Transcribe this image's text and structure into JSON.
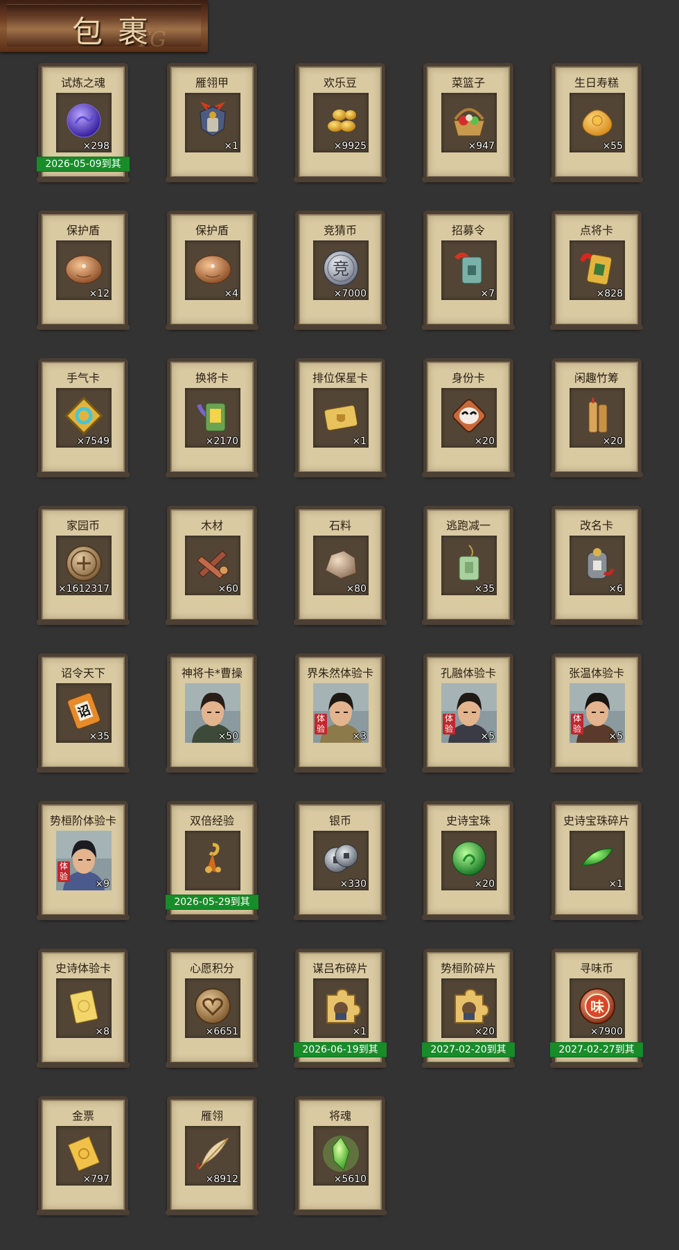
{
  "header": {
    "title": "包裹",
    "deco_text": "TG"
  },
  "items": [
    {
      "name": "试炼之魂",
      "count": "×298",
      "icon": "purple-soul-orb-icon",
      "expiry": "2026-05-09到其"
    },
    {
      "name": "雁翎甲",
      "count": "×1",
      "icon": "armor-icon"
    },
    {
      "name": "欢乐豆",
      "count": "×9925",
      "icon": "gold-beans-icon"
    },
    {
      "name": "菜篮子",
      "count": "×947",
      "icon": "vegetable-basket-icon"
    },
    {
      "name": "生日寿糕",
      "count": "×55",
      "icon": "birthday-cake-icon"
    },
    {
      "name": "保护盾",
      "count": "×12",
      "icon": "shield-icon"
    },
    {
      "name": "保护盾",
      "count": "×4",
      "icon": "shield-icon"
    },
    {
      "name": "竞猜币",
      "count": "×7000",
      "icon": "silver-coin-icon",
      "coin_char": "竞"
    },
    {
      "name": "招募令",
      "count": "×7",
      "icon": "recruit-token-icon"
    },
    {
      "name": "点将卡",
      "count": "×828",
      "icon": "general-card-icon"
    },
    {
      "name": "手气卡",
      "count": "×7549",
      "icon": "luck-card-icon"
    },
    {
      "name": "换将卡",
      "count": "×2170",
      "icon": "swap-card-icon"
    },
    {
      "name": "排位保星卡",
      "count": "×1",
      "icon": "rank-star-card-icon"
    },
    {
      "name": "身份卡",
      "count": "×20",
      "icon": "identity-mask-card-icon"
    },
    {
      "name": "闲趣竹筹",
      "count": "×20",
      "icon": "bamboo-tally-icon"
    },
    {
      "name": "家园币",
      "count": "×1612317",
      "icon": "home-coin-icon"
    },
    {
      "name": "木材",
      "count": "×60",
      "icon": "wood-icon"
    },
    {
      "name": "石料",
      "count": "×80",
      "icon": "stone-icon"
    },
    {
      "name": "逃跑减一",
      "count": "×35",
      "icon": "jade-tag-icon"
    },
    {
      "name": "改名卡",
      "count": "×6",
      "icon": "rename-card-icon"
    },
    {
      "name": "诏令天下",
      "count": "×35",
      "icon": "edict-scroll-icon",
      "scroll_char": "诏"
    },
    {
      "name": "神将卡*曹操",
      "count": "×50",
      "icon": "general-portrait-icon"
    },
    {
      "name": "界朱然体验卡",
      "count": "×3",
      "icon": "general-portrait-icon",
      "trial_tag": "体验"
    },
    {
      "name": "孔融体验卡",
      "count": "×5",
      "icon": "general-portrait-icon",
      "trial_tag": "体验"
    },
    {
      "name": "张温体验卡",
      "count": "×5",
      "icon": "general-portrait-icon",
      "trial_tag": "体验"
    },
    {
      "name": "势桓阶体验卡",
      "count": "×9",
      "icon": "general-portrait-icon",
      "trial_tag": "体验"
    },
    {
      "name": "双倍经验",
      "count": "",
      "icon": "double-exp-icon",
      "expiry": "2026-05-29到其"
    },
    {
      "name": "银币",
      "count": "×330",
      "icon": "silver-coins-icon"
    },
    {
      "name": "史诗宝珠",
      "count": "×20",
      "icon": "green-orb-icon"
    },
    {
      "name": "史诗宝珠碎片",
      "count": "×1",
      "icon": "green-shard-icon"
    },
    {
      "name": "史诗体验卡",
      "count": "×8",
      "icon": "gold-card-icon"
    },
    {
      "name": "心愿积分",
      "count": "×6651",
      "icon": "heart-coin-icon"
    },
    {
      "name": "谋吕布碎片",
      "count": "×1",
      "icon": "puzzle-piece-icon",
      "expiry": "2026-06-19到其"
    },
    {
      "name": "势桓阶碎片",
      "count": "×20",
      "icon": "puzzle-piece-icon",
      "expiry": "2027-02-20到其"
    },
    {
      "name": "寻味币",
      "count": "×7900",
      "icon": "taste-coin-icon",
      "coin_char": "味",
      "expiry": "2027-02-27到其"
    },
    {
      "name": "金票",
      "count": "×797",
      "icon": "gold-ticket-icon"
    },
    {
      "name": "雁翎",
      "count": "×8912",
      "icon": "feather-icon"
    },
    {
      "name": "将魂",
      "count": "×5610",
      "icon": "green-crystal-icon"
    }
  ]
}
